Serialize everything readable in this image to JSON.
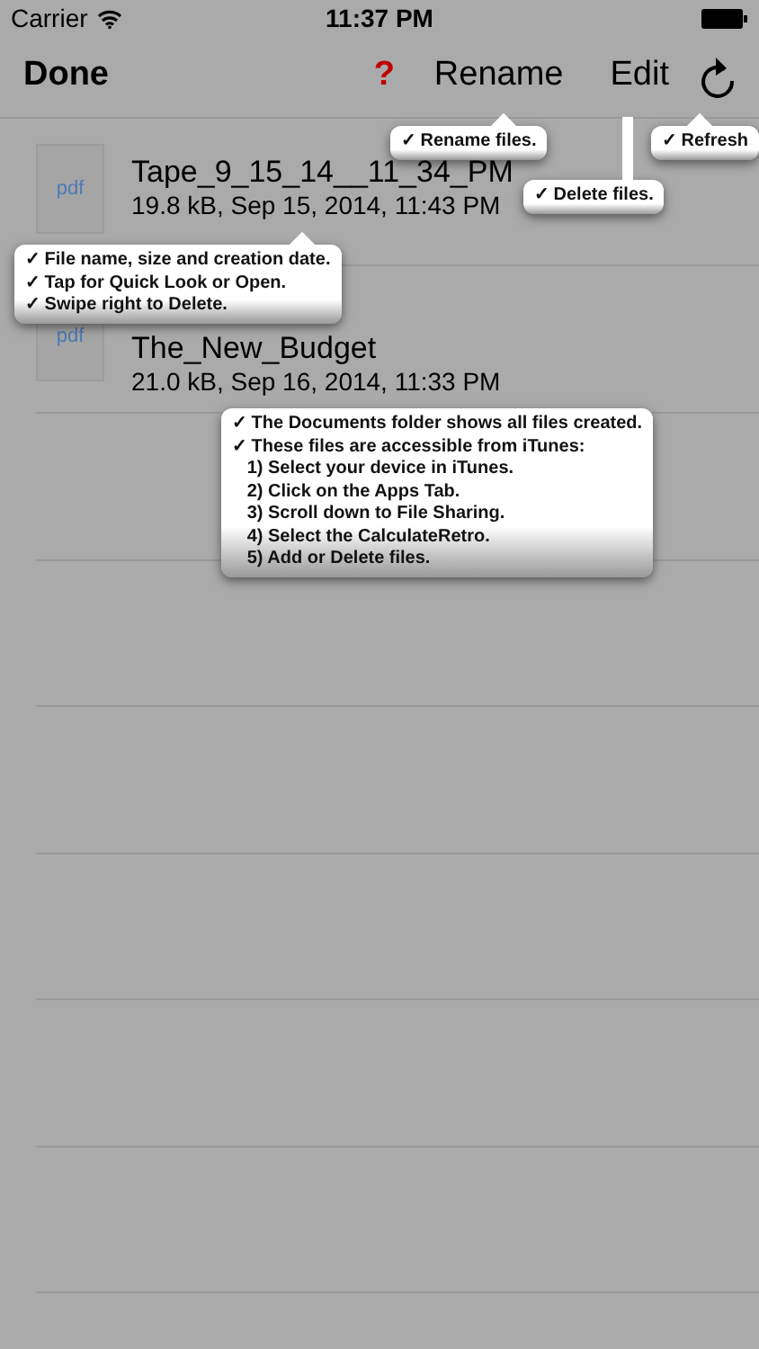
{
  "status_bar": {
    "carrier": "Carrier",
    "time": "11:37 PM"
  },
  "nav_bar": {
    "done": "Done",
    "help": "?",
    "rename": "Rename",
    "edit": "Edit"
  },
  "files": [
    {
      "icon_label": "pdf",
      "name": "Tape_9_15_14__11_34_PM",
      "details": "19.8 kB, Sep 15, 2014, 11:43 PM"
    },
    {
      "icon_label": "pdf",
      "name": "The_New_Budget",
      "details": "21.0 kB, Sep 16, 2014, 11:33 PM"
    }
  ],
  "tips": [
    {
      "lines": [
        "✓ Rename files."
      ]
    },
    {
      "lines": [
        "✓ Refresh"
      ]
    },
    {
      "lines": [
        "✓ Delete files."
      ]
    },
    {
      "lines": [
        "✓ File name, size and creation date.",
        "✓ Tap for Quick Look or Open.",
        "✓ Swipe right to Delete."
      ]
    },
    {
      "lines": [
        "✓ The Documents folder shows all files created.",
        "✓ These files are accessible from iTunes:",
        "   1) Select your device in iTunes.",
        "   2) Click on the Apps Tab.",
        "   3) Scroll down to File Sharing.",
        "   4) Select the CalculateRetro.",
        "   5) Add or Delete files."
      ]
    }
  ]
}
